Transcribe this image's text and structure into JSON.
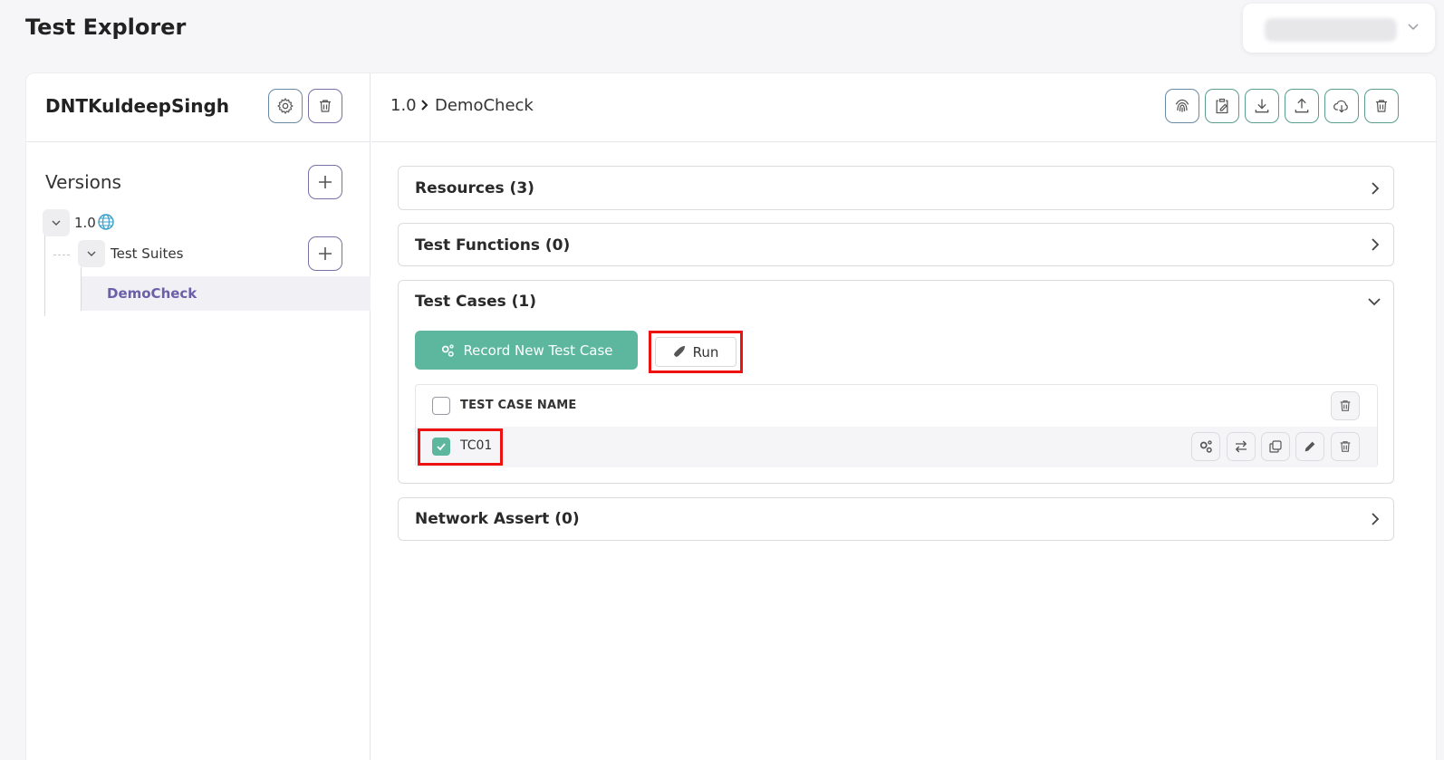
{
  "page": {
    "title": "Test Explorer"
  },
  "project": {
    "name": "DNTKuldeepSingh"
  },
  "versions": {
    "label": "Versions",
    "version_name": "1.0",
    "suites_label": "Test Suites",
    "suite_name": "DemoCheck"
  },
  "breadcrumb": {
    "version": "1.0",
    "suite": "DemoCheck"
  },
  "sections": {
    "resources": "Resources (3)",
    "functions": "Test Functions (0)",
    "cases": "Test Cases (1)",
    "network": "Network Assert (0)"
  },
  "test_cases": {
    "record_label": "Record New Test Case",
    "run_label": "Run",
    "header": "TEST CASE NAME",
    "rows": [
      {
        "name": "TC01",
        "checked": true
      }
    ]
  },
  "colors": {
    "accent": "#5db79e",
    "highlight": "#ee1111",
    "selected_text": "#6a5fa8"
  },
  "icons": [
    "gear-icon",
    "trash-icon",
    "plus-icon",
    "globe-icon",
    "chevron-down-icon",
    "chevron-right-icon",
    "fingerprint-icon",
    "clipboard-edit-icon",
    "download-icon",
    "upload-icon",
    "cloud-download-icon",
    "rocket-icon",
    "cogs-icon",
    "swap-icon",
    "copy-icon",
    "pencil-icon",
    "check-icon"
  ]
}
